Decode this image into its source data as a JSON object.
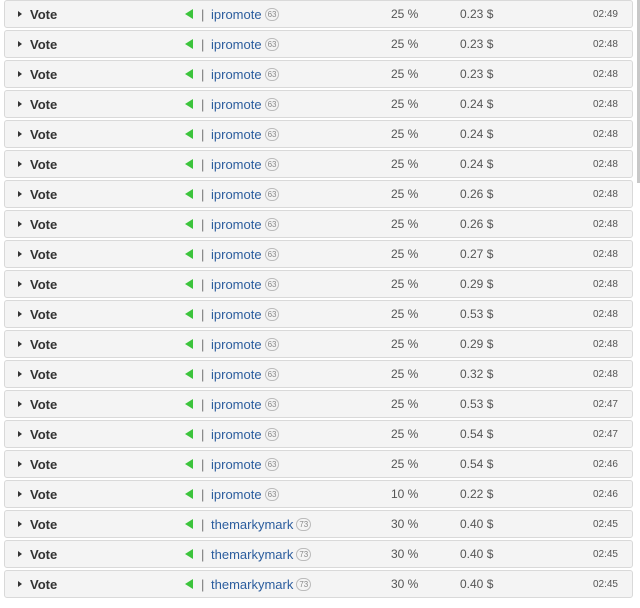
{
  "colors": {
    "row_background": "#f4f4f4",
    "row_border": "#d9d9d9",
    "voter_link": "#2b5d9e",
    "upvote_arrow": "#3cc43c"
  },
  "icons": {
    "expand": "caret-right-icon",
    "vote_direction": "green-triangle-left-icon"
  },
  "votes": [
    {
      "label": "Vote",
      "separator": "|",
      "voter": "ipromote",
      "reputation": "63",
      "weight": "25 %",
      "amount": "0.23 $",
      "time": "02:49"
    },
    {
      "label": "Vote",
      "separator": "|",
      "voter": "ipromote",
      "reputation": "63",
      "weight": "25 %",
      "amount": "0.23 $",
      "time": "02:48"
    },
    {
      "label": "Vote",
      "separator": "|",
      "voter": "ipromote",
      "reputation": "63",
      "weight": "25 %",
      "amount": "0.23 $",
      "time": "02:48"
    },
    {
      "label": "Vote",
      "separator": "|",
      "voter": "ipromote",
      "reputation": "63",
      "weight": "25 %",
      "amount": "0.24 $",
      "time": "02:48"
    },
    {
      "label": "Vote",
      "separator": "|",
      "voter": "ipromote",
      "reputation": "63",
      "weight": "25 %",
      "amount": "0.24 $",
      "time": "02:48"
    },
    {
      "label": "Vote",
      "separator": "|",
      "voter": "ipromote",
      "reputation": "63",
      "weight": "25 %",
      "amount": "0.24 $",
      "time": "02:48"
    },
    {
      "label": "Vote",
      "separator": "|",
      "voter": "ipromote",
      "reputation": "63",
      "weight": "25 %",
      "amount": "0.26 $",
      "time": "02:48"
    },
    {
      "label": "Vote",
      "separator": "|",
      "voter": "ipromote",
      "reputation": "63",
      "weight": "25 %",
      "amount": "0.26 $",
      "time": "02:48"
    },
    {
      "label": "Vote",
      "separator": "|",
      "voter": "ipromote",
      "reputation": "63",
      "weight": "25 %",
      "amount": "0.27 $",
      "time": "02:48"
    },
    {
      "label": "Vote",
      "separator": "|",
      "voter": "ipromote",
      "reputation": "63",
      "weight": "25 %",
      "amount": "0.29 $",
      "time": "02:48"
    },
    {
      "label": "Vote",
      "separator": "|",
      "voter": "ipromote",
      "reputation": "63",
      "weight": "25 %",
      "amount": "0.53 $",
      "time": "02:48"
    },
    {
      "label": "Vote",
      "separator": "|",
      "voter": "ipromote",
      "reputation": "63",
      "weight": "25 %",
      "amount": "0.29 $",
      "time": "02:48"
    },
    {
      "label": "Vote",
      "separator": "|",
      "voter": "ipromote",
      "reputation": "63",
      "weight": "25 %",
      "amount": "0.32 $",
      "time": "02:48"
    },
    {
      "label": "Vote",
      "separator": "|",
      "voter": "ipromote",
      "reputation": "63",
      "weight": "25 %",
      "amount": "0.53 $",
      "time": "02:47"
    },
    {
      "label": "Vote",
      "separator": "|",
      "voter": "ipromote",
      "reputation": "63",
      "weight": "25 %",
      "amount": "0.54 $",
      "time": "02:47"
    },
    {
      "label": "Vote",
      "separator": "|",
      "voter": "ipromote",
      "reputation": "63",
      "weight": "25 %",
      "amount": "0.54 $",
      "time": "02:46"
    },
    {
      "label": "Vote",
      "separator": "|",
      "voter": "ipromote",
      "reputation": "63",
      "weight": "10 %",
      "amount": "0.22 $",
      "time": "02:46"
    },
    {
      "label": "Vote",
      "separator": "|",
      "voter": "themarkymark",
      "reputation": "73",
      "weight": "30 %",
      "amount": "0.40 $",
      "time": "02:45"
    },
    {
      "label": "Vote",
      "separator": "|",
      "voter": "themarkymark",
      "reputation": "73",
      "weight": "30 %",
      "amount": "0.40 $",
      "time": "02:45"
    },
    {
      "label": "Vote",
      "separator": "|",
      "voter": "themarkymark",
      "reputation": "73",
      "weight": "30 %",
      "amount": "0.40 $",
      "time": "02:45"
    }
  ]
}
